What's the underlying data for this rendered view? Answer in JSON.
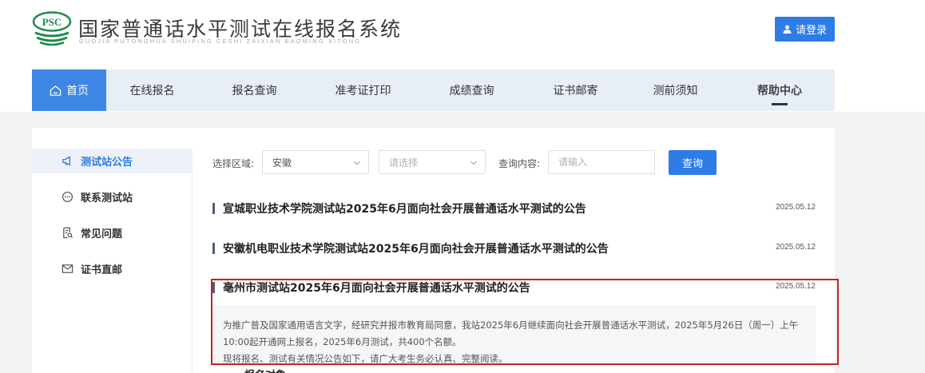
{
  "header": {
    "logo_text": "PSC",
    "title": "国家普通话水平测试在线报名系统",
    "subtitle": "GUOJIA PUTONGHUA SHUIPING CESHI ZAIXIAN BAOMING XITONG",
    "login_label": "请登录"
  },
  "nav": {
    "items": [
      {
        "label": "首页"
      },
      {
        "label": "在线报名"
      },
      {
        "label": "报名查询"
      },
      {
        "label": "准考证打印"
      },
      {
        "label": "成绩查询"
      },
      {
        "label": "证书邮寄"
      },
      {
        "label": "测前须知"
      },
      {
        "label": "帮助中心"
      }
    ]
  },
  "sidebar": {
    "items": [
      {
        "label": "测试站公告",
        "icon": "megaphone-icon"
      },
      {
        "label": "联系测试站",
        "icon": "chat-icon"
      },
      {
        "label": "常见问题",
        "icon": "document-search-icon"
      },
      {
        "label": "证书直邮",
        "icon": "mail-icon"
      }
    ]
  },
  "filter": {
    "region_label": "选择区域:",
    "province_value": "安徽",
    "city_placeholder": "请选择",
    "query_label": "查询内容:",
    "query_placeholder": "请输入",
    "query_button": "查询"
  },
  "notices": [
    {
      "title": "宣城职业技术学院测试站2025年6月面向社会开展普通话水平测试的公告",
      "date": "2025.05.12"
    },
    {
      "title": "安徽机电职业技术学院测试站2025年6月面向社会开展普通话水平测试的公告",
      "date": "2025.05.12"
    },
    {
      "title": "亳州市测试站2025年6月面向社会开展普通话水平测试的公告",
      "date": "2025.05.12"
    }
  ],
  "excerpt": {
    "line1": "为推广普及国家通用语言文字，经研究并报市教育局同意，我站2025年6月继续面向社会开展普通话水平测试，2025年5月26日（周一）上午",
    "line2": "10:00起开通网上报名，2025年6月测试，共400个名额。",
    "line3": "现将报名、测试有关情况公告如下，请广大考生务必认真、完整阅读。"
  },
  "section_heading": "一、报名对象",
  "colors": {
    "primary": "#2e7ce6",
    "nav_bg": "#e8eef6",
    "highlight": "#cc1f1f"
  }
}
